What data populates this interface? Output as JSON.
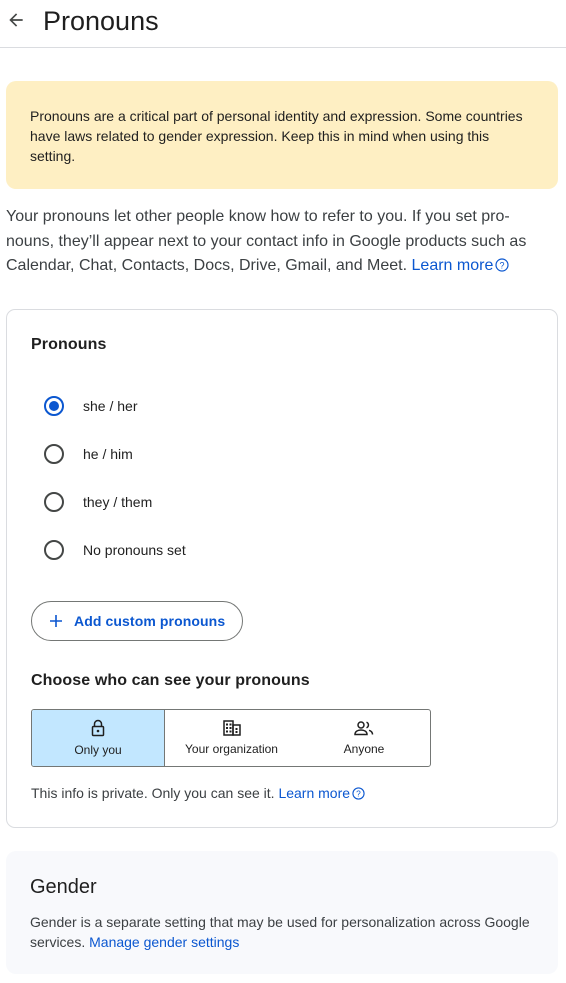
{
  "header": {
    "title": "Pronouns"
  },
  "warning": {
    "text": "Pronouns are a critical part of personal identity and expression. Some countries have laws related to gender expression. Keep this in mind when using this setting."
  },
  "intro": {
    "text": "Your pronouns let other people know how to refer to you. If you set pro-nouns, they’ll appear next to your contact info in Google products such as Calendar, Chat, Contacts, Docs, Drive, Gmail, and Meet.",
    "link": "Learn more"
  },
  "pronouns_card": {
    "title": "Pronouns",
    "options": [
      {
        "label": "she / her",
        "selected": true
      },
      {
        "label": "he / him",
        "selected": false
      },
      {
        "label": "they / them",
        "selected": false
      },
      {
        "label": "No pronouns set",
        "selected": false
      }
    ],
    "add_button": "Add custom pronouns",
    "visibility_title": "Choose who can see your pronouns",
    "visibility_options": [
      {
        "label": "Only you",
        "icon": "lock-icon",
        "selected": true
      },
      {
        "label": "Your organization",
        "icon": "building-icon",
        "selected": false
      },
      {
        "label": "Anyone",
        "icon": "people-icon",
        "selected": false
      }
    ],
    "privacy_text": "This info is private. Only you can see it.",
    "privacy_link": "Learn more"
  },
  "gender_card": {
    "title": "Gender",
    "text": "Gender is a separate setting that may be used for personalization across Google services.",
    "link": "Manage gender settings"
  },
  "colors": {
    "accent": "#0b57d0",
    "warning_bg": "#feefc3",
    "selected_segment_bg": "#c2e7ff"
  }
}
